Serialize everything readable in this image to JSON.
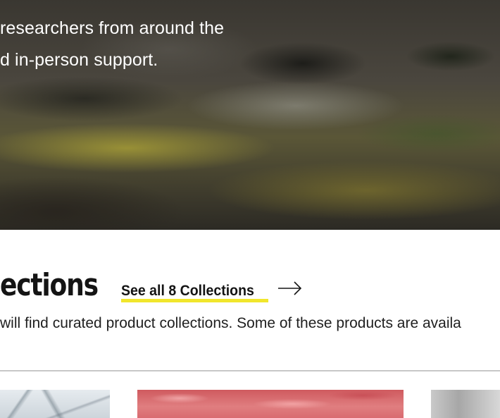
{
  "hero": {
    "line1": "researchers from around the",
    "line2": "d in-person support."
  },
  "collections": {
    "heading": "ections",
    "see_all_label": "See all 8 Collections",
    "intro": "will find curated product collections. Some of these products are availa"
  },
  "icons": {
    "arrow": "arrow-right-icon"
  },
  "colors": {
    "accent_underline": "#f1e62c",
    "text": "#141414",
    "divider": "#c7c7c7"
  }
}
